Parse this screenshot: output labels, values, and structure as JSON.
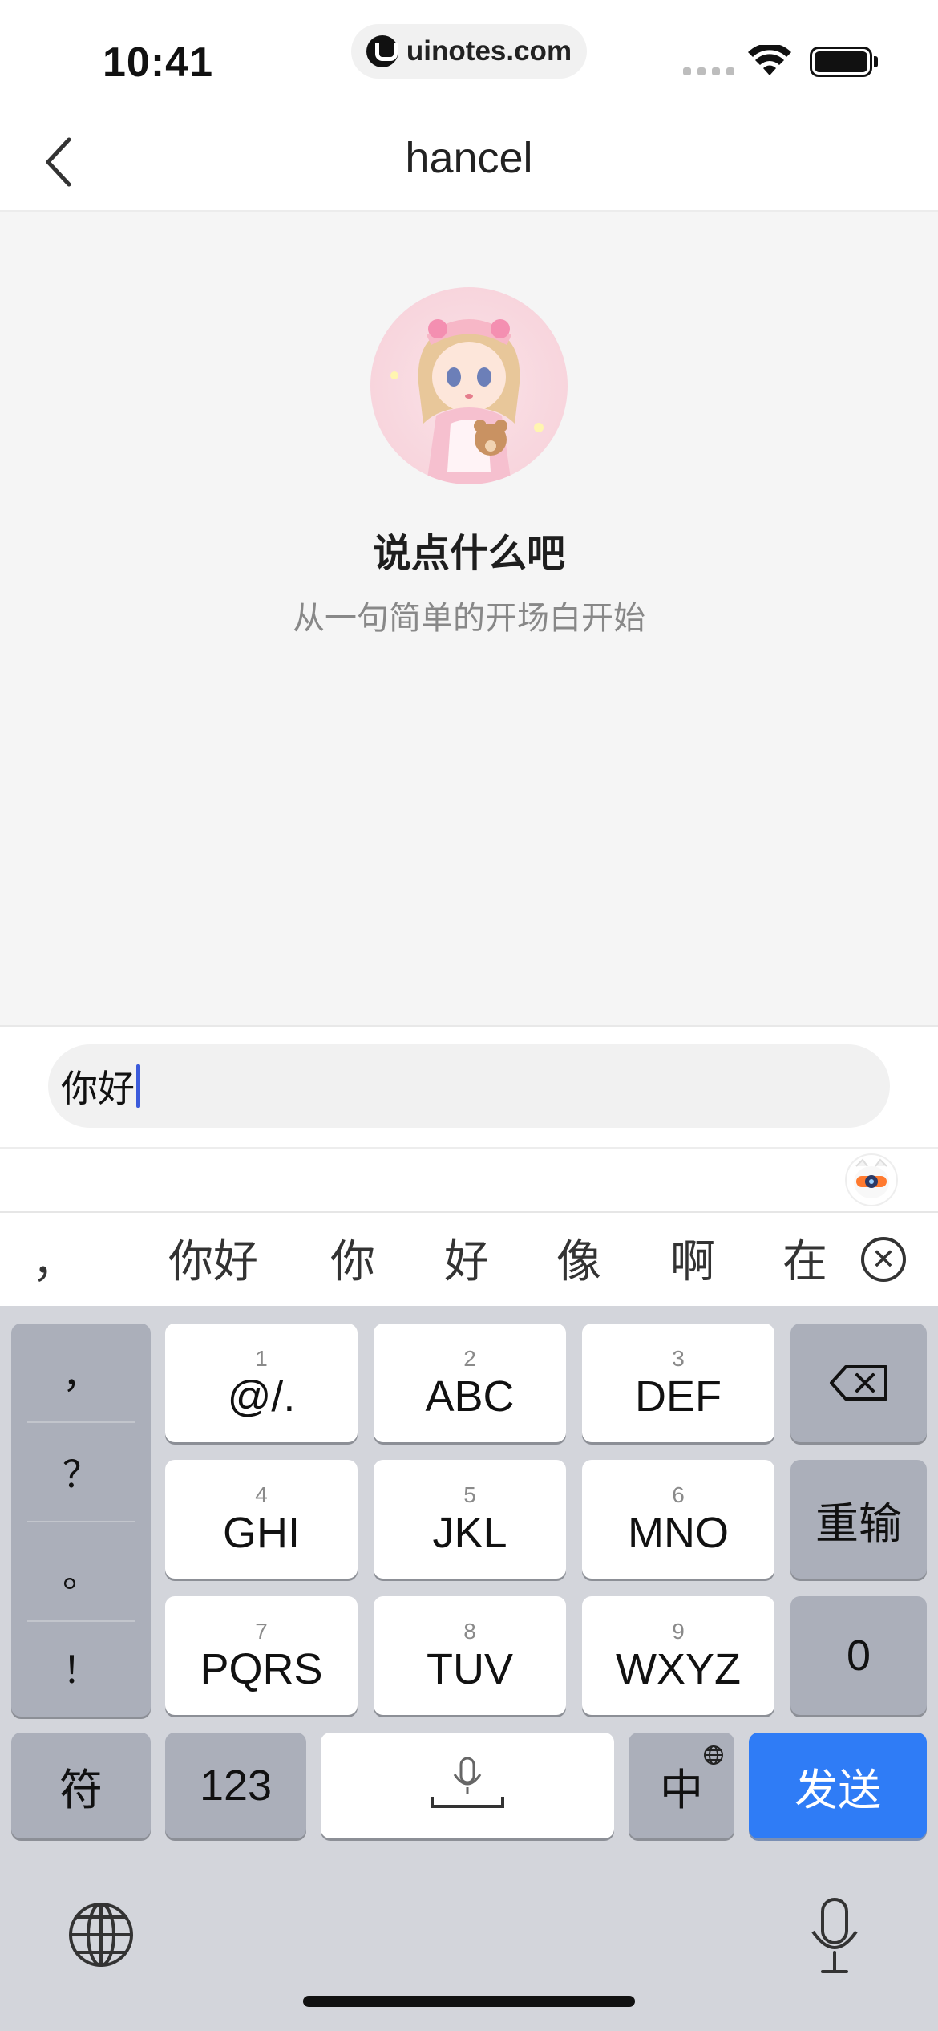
{
  "status_bar": {
    "time": "10:41",
    "url": "uinotes.com"
  },
  "nav": {
    "title": "hancel"
  },
  "chat": {
    "empty_title": "说点什么吧",
    "empty_subtitle": "从一句简单的开场白开始"
  },
  "input": {
    "value": "你好"
  },
  "candidates": {
    "punct": "，",
    "items": [
      "你好",
      "你",
      "好",
      "像",
      "啊",
      "在"
    ]
  },
  "keyboard": {
    "punctuation": [
      "，",
      "？",
      "。",
      "！"
    ],
    "keys": [
      {
        "num": "1",
        "letters": "@/."
      },
      {
        "num": "2",
        "letters": "ABC"
      },
      {
        "num": "3",
        "letters": "DEF"
      },
      {
        "num": "4",
        "letters": "GHI"
      },
      {
        "num": "5",
        "letters": "JKL"
      },
      {
        "num": "6",
        "letters": "MNO"
      },
      {
        "num": "7",
        "letters": "PQRS"
      },
      {
        "num": "8",
        "letters": "TUV"
      },
      {
        "num": "9",
        "letters": "WXYZ"
      }
    ],
    "reenter": "重输",
    "zero": "0",
    "symbols": "符",
    "numbers": "123",
    "lang": "中",
    "send": "发送"
  },
  "colors": {
    "accent": "#2f7cf6",
    "caret": "#3b5bdb",
    "chat_bg": "#f5f5f5",
    "keyboard_bg": "#d3d5db"
  }
}
